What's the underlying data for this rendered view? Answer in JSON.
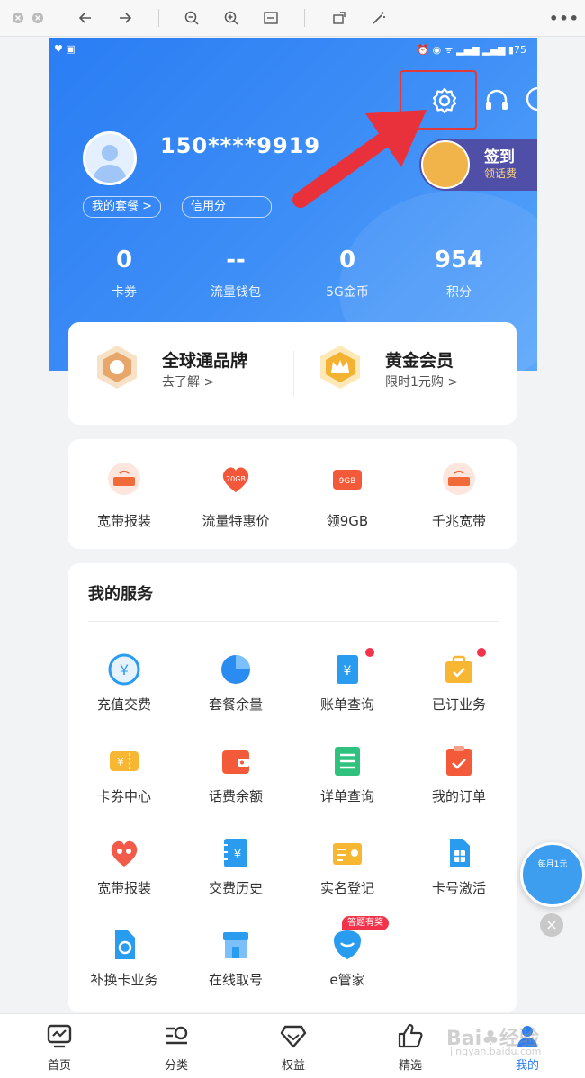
{
  "toolbar": {
    "icons": [
      "close-icon",
      "minimize-icon",
      "back-arrow-icon",
      "forward-arrow-icon",
      "zoom-out-icon",
      "zoom-in-icon",
      "fit-screen-icon",
      "rotate-icon",
      "magic-wand-icon",
      "more-icon"
    ]
  },
  "profile": {
    "phone": "150****9919",
    "sub": "",
    "pill_plan": "我的套餐 >",
    "pill_credit": "信用分"
  },
  "signin": {
    "title": "签到",
    "sub": "领话费"
  },
  "stats": [
    {
      "value": "0",
      "label": "卡券"
    },
    {
      "value": "--",
      "label": "流量钱包"
    },
    {
      "value": "0",
      "label": "5G金币"
    },
    {
      "value": "954",
      "label": "积分"
    }
  ],
  "brands": [
    {
      "title": "全球通品牌",
      "sub": "去了解 >"
    },
    {
      "title": "黄金会员",
      "sub": "限时1元购 >"
    }
  ],
  "quick": [
    {
      "label": "宽带报装"
    },
    {
      "label": "流量特惠价",
      "badge": "20GB"
    },
    {
      "label": "领9GB",
      "badge": "9GB"
    },
    {
      "label": "千兆宽带"
    }
  ],
  "services": {
    "title": "我的服务",
    "items": [
      {
        "label": "充值交费"
      },
      {
        "label": "套餐余量"
      },
      {
        "label": "账单查询"
      },
      {
        "label": "已订业务"
      },
      {
        "label": "卡券中心"
      },
      {
        "label": "话费余额"
      },
      {
        "label": "详单查询"
      },
      {
        "label": "我的订单"
      },
      {
        "label": "宽带报装"
      },
      {
        "label": "交费历史"
      },
      {
        "label": "实名登记"
      },
      {
        "label": "卡号激活"
      },
      {
        "label": "补换卡业务"
      },
      {
        "label": "在线取号"
      },
      {
        "label": "e管家",
        "tag": "答题有奖"
      }
    ]
  },
  "float_ad": {
    "text": "每月1元"
  },
  "tabs": [
    {
      "label": "首页"
    },
    {
      "label": "分类"
    },
    {
      "label": "权益"
    },
    {
      "label": "精选"
    },
    {
      "label": "我的"
    }
  ],
  "colors": {
    "primary": "#2a7df3",
    "active_tab": "#2a7df3",
    "highlight": "#e03a3a"
  }
}
